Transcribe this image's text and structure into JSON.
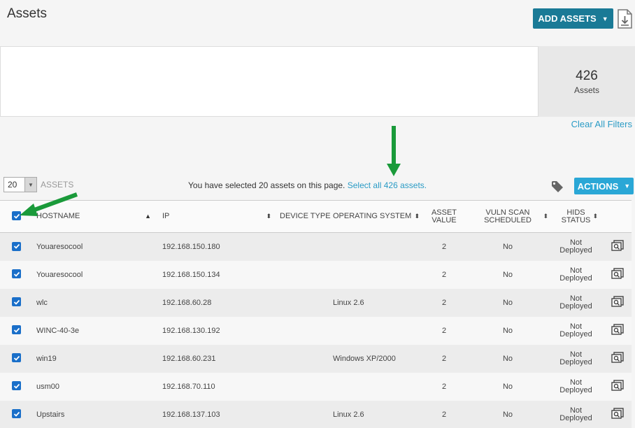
{
  "header": {
    "title": "Assets",
    "add_button": "ADD ASSETS",
    "add_caret": "▼"
  },
  "summary": {
    "count": "426",
    "count_label": "Assets",
    "clear_filters": "Clear All Filters"
  },
  "toolbar": {
    "page_size": "20",
    "page_size_caret": "▼",
    "assets_label": "ASSETS",
    "selection_text": "You have selected 20 assets on this page.",
    "select_all_link": "Select all 426 assets.",
    "actions_label": "ACTIONS",
    "actions_caret": "▼"
  },
  "table": {
    "columns": {
      "hostname": "HOSTNAME",
      "ip": "IP",
      "device_type": "DEVICE TYPE",
      "os": "OPERATING SYSTEM",
      "asset_value_1": "ASSET",
      "asset_value_2": "VALUE",
      "vuln_1": "VULN SCAN",
      "vuln_2": "SCHEDULED",
      "hids_1": "HIDS",
      "hids_2": "STATUS"
    },
    "sort_asc": "▲",
    "sort_both": "⬍",
    "rows": [
      {
        "hostname": "Youaresocool",
        "ip": "192.168.150.180",
        "device_type": "",
        "os": "",
        "asset_value": "2",
        "vuln": "No",
        "hids_1": "Not",
        "hids_2": "Deployed"
      },
      {
        "hostname": "Youaresocool",
        "ip": "192.168.150.134",
        "device_type": "",
        "os": "",
        "asset_value": "2",
        "vuln": "No",
        "hids_1": "Not",
        "hids_2": "Deployed"
      },
      {
        "hostname": "wlc",
        "ip": "192.168.60.28",
        "device_type": "",
        "os": "Linux 2.6",
        "asset_value": "2",
        "vuln": "No",
        "hids_1": "Not",
        "hids_2": "Deployed"
      },
      {
        "hostname": "WINC-40-3e",
        "ip": "192.168.130.192",
        "device_type": "",
        "os": "",
        "asset_value": "2",
        "vuln": "No",
        "hids_1": "Not",
        "hids_2": "Deployed"
      },
      {
        "hostname": "win19",
        "ip": "192.168.60.231",
        "device_type": "",
        "os": "Windows XP/2000",
        "asset_value": "2",
        "vuln": "No",
        "hids_1": "Not",
        "hids_2": "Deployed"
      },
      {
        "hostname": "usm00",
        "ip": "192.168.70.110",
        "device_type": "",
        "os": "",
        "asset_value": "2",
        "vuln": "No",
        "hids_1": "Not",
        "hids_2": "Deployed"
      },
      {
        "hostname": "Upstairs",
        "ip": "192.168.137.103",
        "device_type": "",
        "os": "Linux 2.6",
        "asset_value": "2",
        "vuln": "No",
        "hids_1": "Not",
        "hids_2": "Deployed"
      }
    ]
  },
  "colors": {
    "add_button": "#1a7a96",
    "actions_button": "#2aa7d6",
    "link": "#2a9bc5",
    "checkbox": "#1a6fc9",
    "annotation_arrow": "#1a9a3a"
  },
  "icons": {
    "download": "download-icon",
    "tag": "tag-icon",
    "row_detail": "asset-detail-icon",
    "checkbox": "checkbox-checked-icon"
  }
}
